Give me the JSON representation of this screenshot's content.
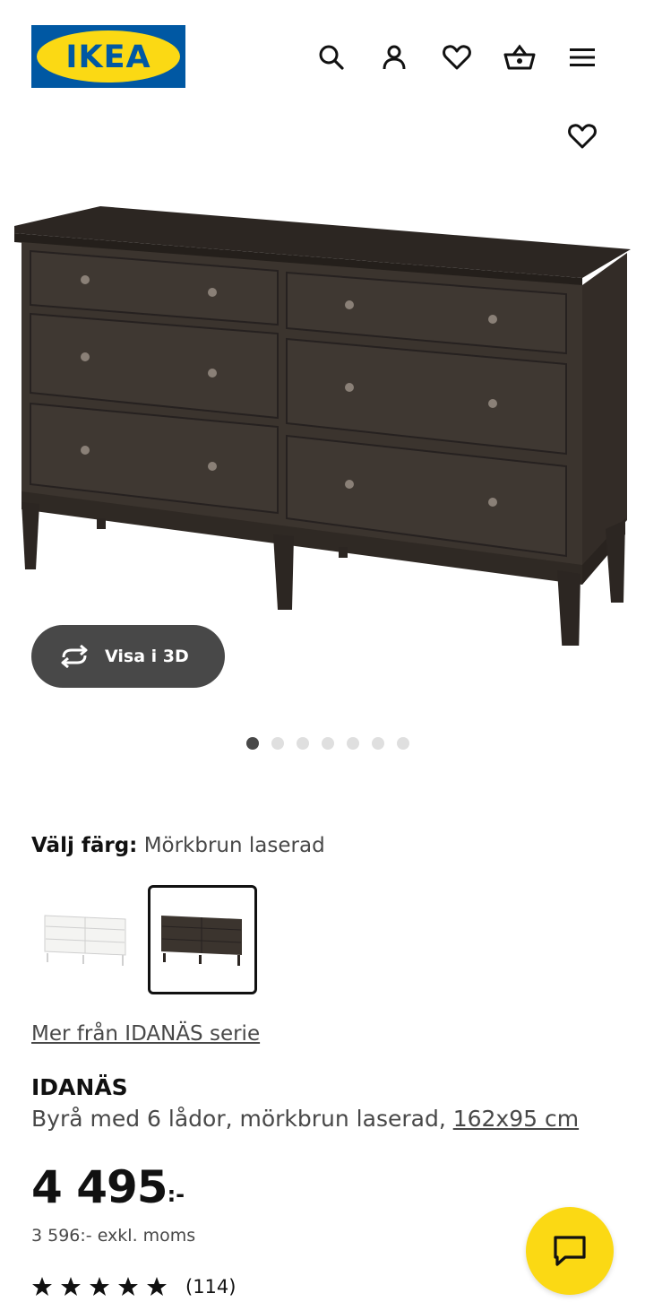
{
  "header": {
    "logo_text": "IKEA",
    "icons": [
      "search-icon",
      "profile-icon",
      "favourites-icon",
      "cart-icon",
      "menu-icon"
    ]
  },
  "hero": {
    "view_3d_label": "Visa i 3D",
    "image_count": 7,
    "active_image": 1
  },
  "color_choice": {
    "label": "Välj färg:",
    "value": "Mörkbrun laserad",
    "options": [
      "white",
      "dark brown"
    ],
    "selected_index": 1
  },
  "series_link": "Mer från IDANÄS serie",
  "product": {
    "name": "IDANÄS",
    "description": "Byrå med 6 lådor, mörkbrun laserad, ",
    "measurement": "162x95 cm",
    "price": "4 495",
    "price_suffix": ":-",
    "price_excl_vat": "3 596:- exkl. moms",
    "rating_stars": 5,
    "review_count": "(114)"
  },
  "colors": {
    "brand_blue": "#0058a3",
    "brand_yellow": "#fbd914",
    "dark_text": "#111111",
    "muted_text": "#484848",
    "dresser_dark": "#3b342e"
  }
}
